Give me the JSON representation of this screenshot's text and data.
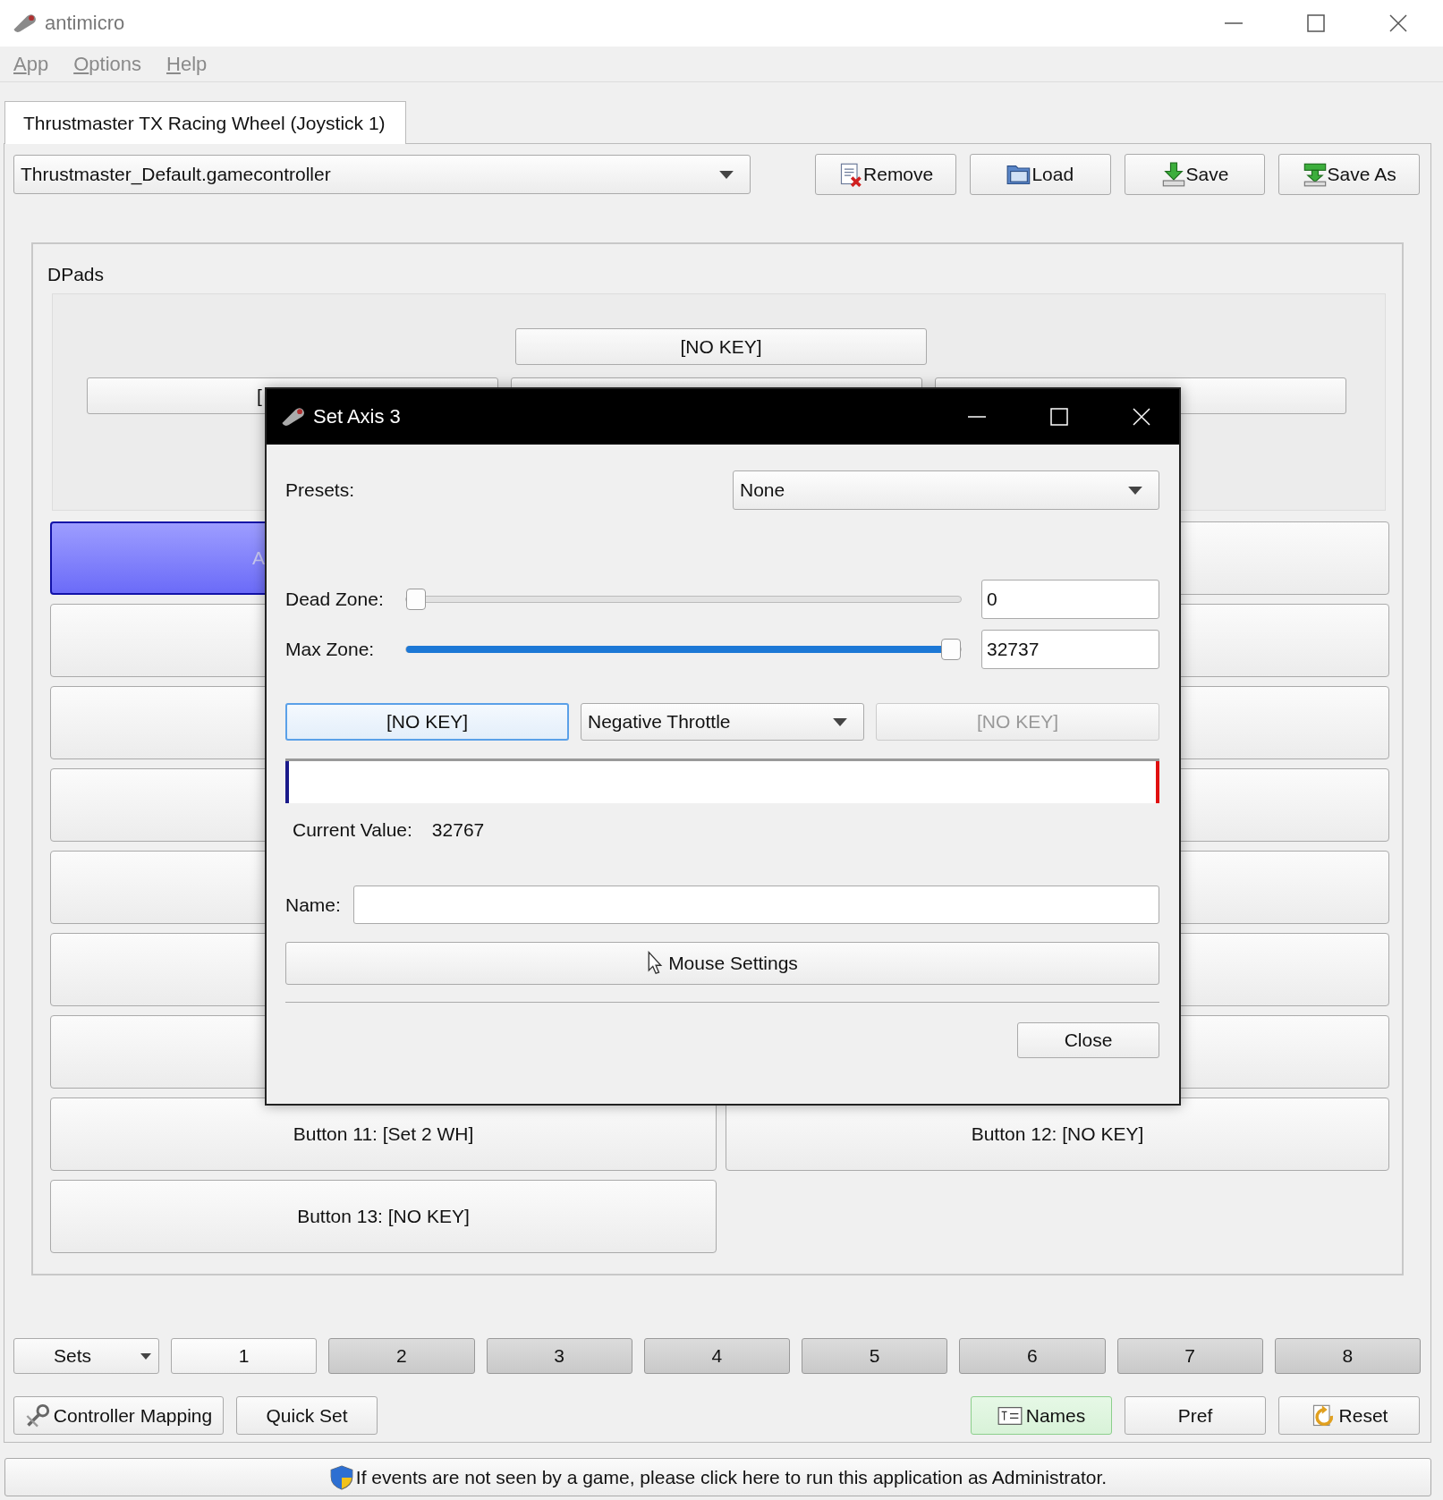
{
  "window": {
    "title": "antimicro"
  },
  "menu": [
    {
      "label": "App",
      "disabled": true
    },
    {
      "label": "Options",
      "disabled": true
    },
    {
      "label": "Help",
      "disabled": true
    }
  ],
  "tabs": [
    {
      "label": "Thrustmaster TX Racing Wheel (Joystick 1)",
      "selected": true
    }
  ],
  "profile": {
    "value": "Thrustmaster_Default.gamecontroller"
  },
  "toolbar": [
    {
      "label": "Remove",
      "kind": "remove"
    },
    {
      "label": "Load",
      "kind": "load"
    },
    {
      "label": "Save",
      "kind": "save"
    },
    {
      "label": "Save As",
      "kind": "saveas"
    }
  ],
  "group": {
    "title": "DPads",
    "dpad_top": {
      "label": "[NO KEY]"
    },
    "dpad_row": [
      {
        "label": "[",
        "kind": "key"
      },
      {
        "kind": "key"
      },
      {
        "kind": "key"
      }
    ],
    "axis_buttons": [
      {
        "label": "A",
        "selected": true
      },
      {
        "selected": false
      },
      {
        "selected": false
      },
      {
        "selected": false
      },
      {
        "selected": false
      },
      {
        "selected": false
      },
      {
        "selected": false
      },
      {
        "selected": false
      },
      {
        "selected": false
      },
      {
        "selected": false
      },
      {
        "selected": false
      },
      {
        "selected": false
      },
      {
        "selected": false
      },
      {
        "selected": false
      },
      {
        "label": "Button 11: [Set 2 WH]",
        "selected": false
      },
      {
        "label": "Button 12: [NO KEY]",
        "selected": false
      },
      {
        "label": "Button 13: [NO KEY]",
        "selected": false
      }
    ]
  },
  "sets": {
    "label": "Sets",
    "items": [
      {
        "label": "1",
        "selected": true
      },
      {
        "label": "2",
        "selected": false
      },
      {
        "label": "3",
        "selected": false
      },
      {
        "label": "4",
        "selected": false
      },
      {
        "label": "5",
        "selected": false
      },
      {
        "label": "6",
        "selected": false
      },
      {
        "label": "7",
        "selected": false
      },
      {
        "label": "8",
        "selected": false
      }
    ]
  },
  "bottom_left": [
    {
      "label": "Controller Mapping",
      "kind": "mapping",
      "selected": false
    },
    {
      "label": "Quick Set",
      "kind": "plain",
      "selected": false
    }
  ],
  "bottom_right": [
    {
      "label": "Names",
      "kind": "names",
      "selected": true
    },
    {
      "label": "Pref",
      "kind": "plain",
      "selected": false
    },
    {
      "label": "Reset",
      "kind": "reset",
      "selected": false
    }
  ],
  "status": {
    "text": "If events are not seen by a game, please click here to run this application as Administrator."
  },
  "dialog": {
    "title": "Set Axis 3",
    "presets_label": "Presets:",
    "preset": "None",
    "dead_zone": {
      "label": "Dead Zone:",
      "level": 0,
      "value": "0"
    },
    "max_zone": {
      "label": "Max Zone:",
      "level": 1,
      "value": "32737"
    },
    "negative_key": {
      "label": "[NO KEY]",
      "disabled": false,
      "focused": true
    },
    "throttle": "Negative Throttle",
    "positive_key": {
      "label": "[NO KEY]",
      "disabled": true,
      "focused": false
    },
    "meter": {
      "level": 1
    },
    "current_value": {
      "label": "Current Value:",
      "value": "32767"
    },
    "name_label": "Name:",
    "mouse_settings": "Mouse Settings",
    "close": "Close"
  }
}
